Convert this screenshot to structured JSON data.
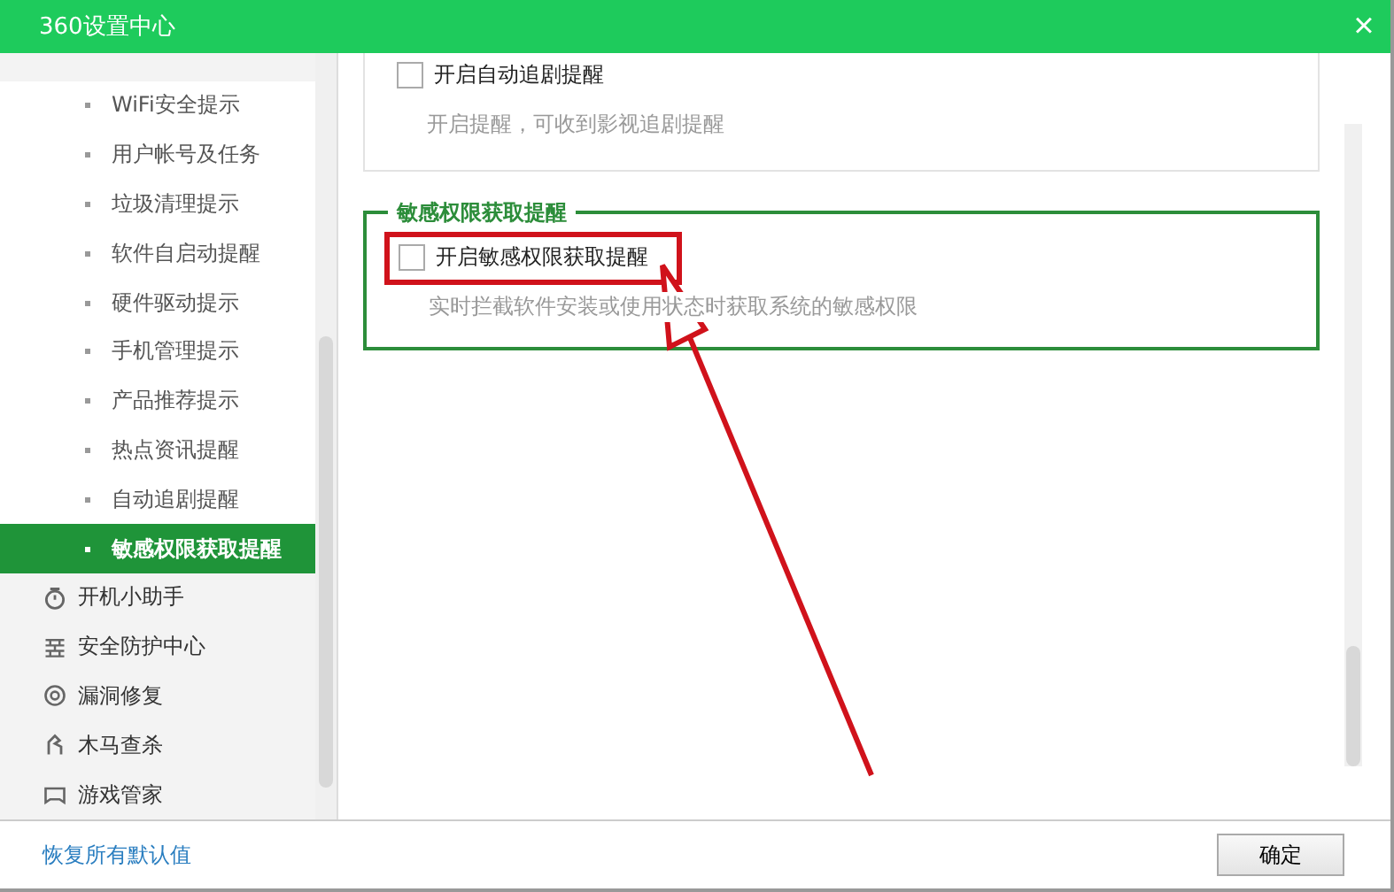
{
  "window": {
    "title": "360设置中心",
    "close": "×"
  },
  "sidebar": {
    "items": [
      {
        "label": "WiFi安全提示",
        "kind": "sub",
        "selected": false
      },
      {
        "label": "用户帐号及任务",
        "kind": "sub",
        "selected": false
      },
      {
        "label": "垃圾清理提示",
        "kind": "sub",
        "selected": false
      },
      {
        "label": "软件自启动提醒",
        "kind": "sub",
        "selected": false
      },
      {
        "label": "硬件驱动提示",
        "kind": "sub",
        "selected": false
      },
      {
        "label": "手机管理提示",
        "kind": "sub",
        "selected": false
      },
      {
        "label": "产品推荐提示",
        "kind": "sub",
        "selected": false
      },
      {
        "label": "热点资讯提醒",
        "kind": "sub",
        "selected": false
      },
      {
        "label": "自动追剧提醒",
        "kind": "sub",
        "selected": false
      },
      {
        "label": "敏感权限获取提醒",
        "kind": "sub",
        "selected": true
      },
      {
        "label": "开机小助手",
        "kind": "main",
        "selected": false
      },
      {
        "label": "安全防护中心",
        "kind": "main",
        "selected": false
      },
      {
        "label": "漏洞修复",
        "kind": "main",
        "selected": false
      },
      {
        "label": "木马查杀",
        "kind": "main",
        "selected": false
      },
      {
        "label": "游戏管家",
        "kind": "main",
        "selected": false
      }
    ]
  },
  "sections": [
    {
      "checkbox": {
        "label": "开启自动追剧提醒",
        "checked": false
      },
      "description": "开启提醒，可收到影视追剧提醒"
    },
    {
      "legend": "敏感权限获取提醒",
      "checkbox": {
        "label": "开启敏感权限获取提醒",
        "checked": false
      },
      "description": "实时拦截软件安装或使用状态时获取系统的敏感权限"
    }
  ],
  "footer": {
    "restore_link": "恢复所有默认值",
    "ok_button": "确定"
  }
}
